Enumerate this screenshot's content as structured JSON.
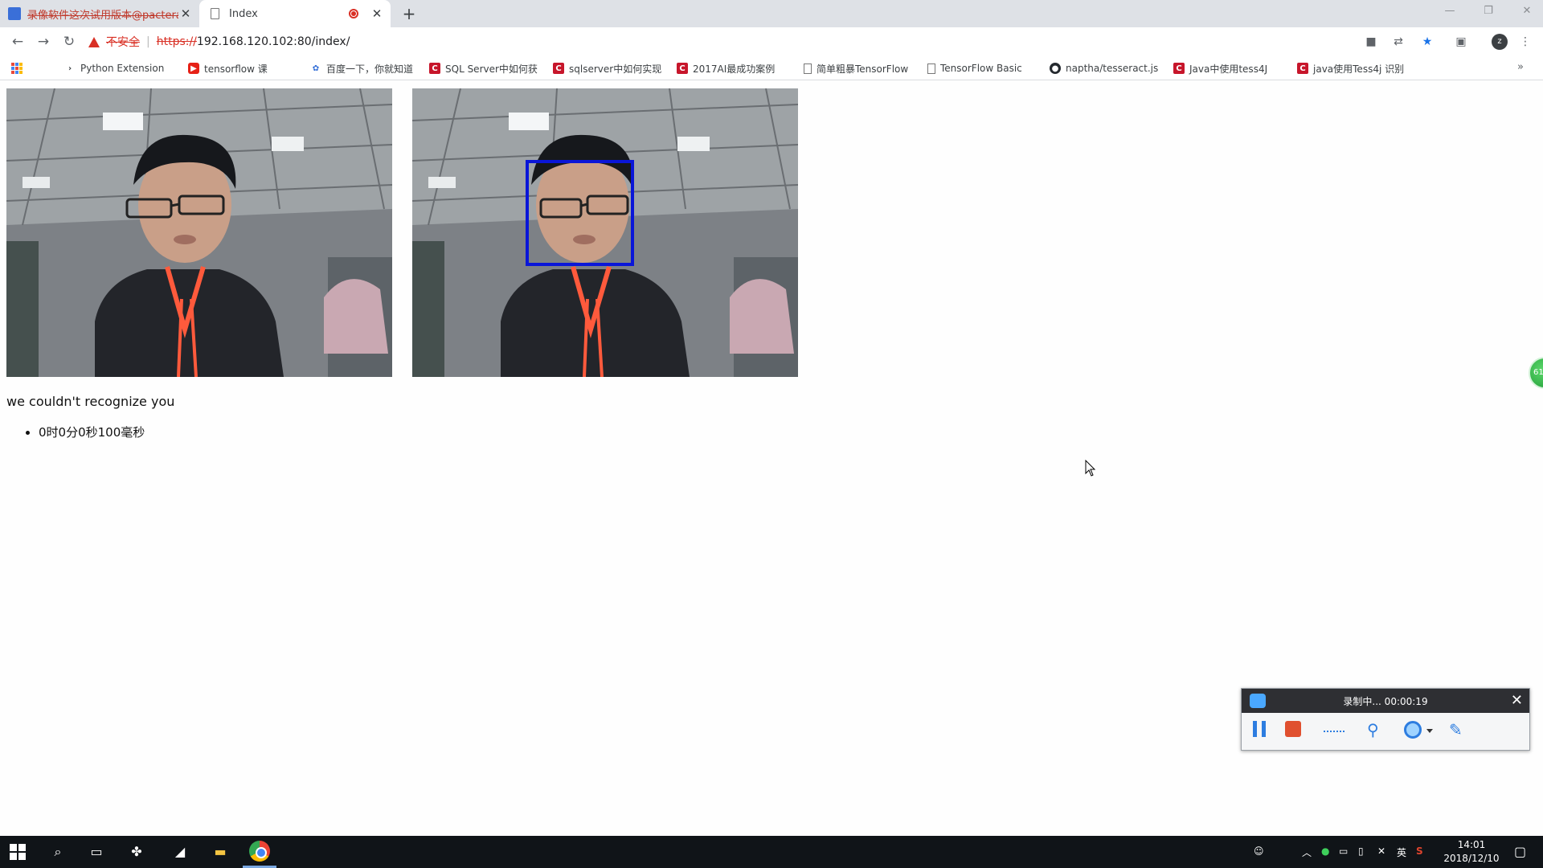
{
  "browser": {
    "tabs": [
      {
        "label": "录像软件这次试用版本@pactera",
        "active": false
      },
      {
        "label": "Index",
        "active": true
      }
    ],
    "omnibox": {
      "security_label": "不安全",
      "scheme": "https://",
      "url": "192.168.120.102:80/index/"
    },
    "avatar_letter": "z",
    "bookmarks": [
      {
        "label": "Python Extension"
      },
      {
        "label": "tensorflow 课"
      },
      {
        "label": "百度一下，你就知道"
      },
      {
        "label": "SQL Server中如何获"
      },
      {
        "label": "sqlserver中如何实现"
      },
      {
        "label": "2017AI最成功案例"
      },
      {
        "label": "简单粗暴TensorFlow"
      },
      {
        "label": "TensorFlow Basic"
      },
      {
        "label": "naptha/tesseract.js"
      },
      {
        "label": "Java中使用tess4J"
      },
      {
        "label": "java使用Tess4j 识别"
      }
    ]
  },
  "page": {
    "status": "we couldn't recognize you",
    "timings": [
      "0时0分0秒100毫秒"
    ]
  },
  "side_badge": "61",
  "recorder": {
    "status": "录制中... 00:00:19"
  },
  "taskbar": {
    "ime": "英",
    "time": "14:01",
    "date": "2018/12/10"
  },
  "colors": {
    "detection_box": "#0a16d8",
    "jacket_zipper": "#ff5a3c",
    "insecure_red": "#d93025"
  }
}
